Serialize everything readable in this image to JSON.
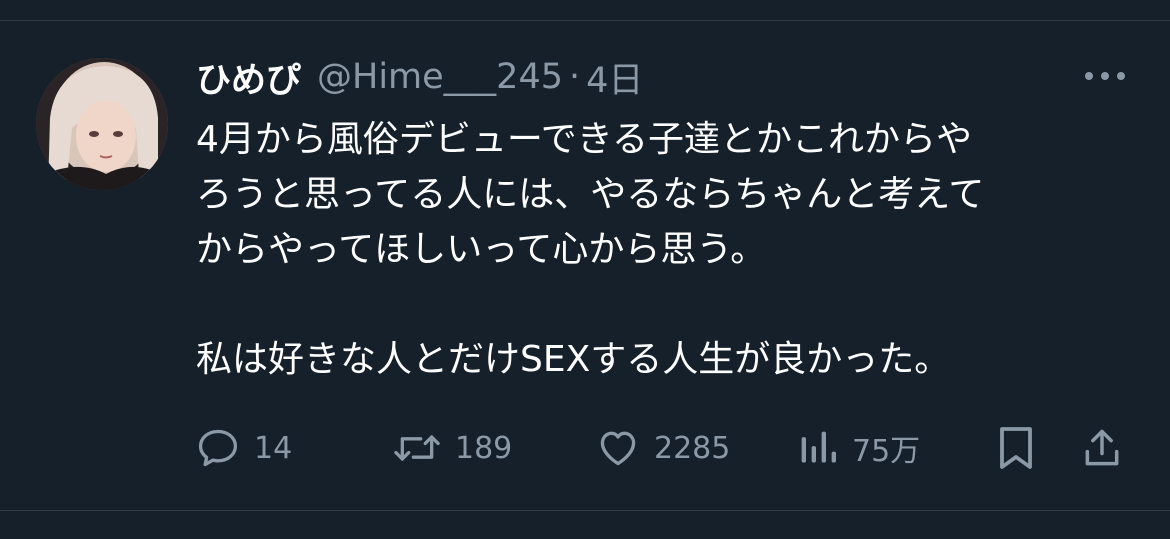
{
  "tweet": {
    "display_name": "ひめぴ",
    "handle": "@Hime___245",
    "separator": "·",
    "time": "4日",
    "body_lines": [
      "4月から風俗デビューできる子達とかこれからや",
      "ろうと思ってる人には、やるならちゃんと考えて",
      "からやってほしいって心から思う。"
    ],
    "body_last": "私は好きな人とだけSEXする人生が良かった。"
  },
  "actions": {
    "reply_count": "14",
    "retweet_count": "189",
    "like_count": "2285",
    "views_count": "75万"
  },
  "colors": {
    "background": "#15202b",
    "text_primary": "#ffffff",
    "text_secondary": "#8b98a5"
  },
  "icons": {
    "reply": "reply-icon",
    "retweet": "retweet-icon",
    "like": "heart-icon",
    "views": "views-icon",
    "bookmark": "bookmark-icon",
    "share": "share-icon",
    "more": "more-icon"
  }
}
